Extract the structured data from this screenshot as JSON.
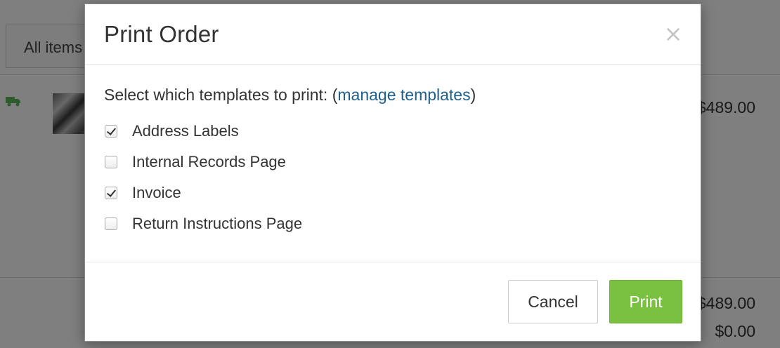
{
  "background": {
    "filter_label": "All items",
    "rows": [
      {
        "amount": "$489.00"
      }
    ],
    "totals": [
      "$489.00",
      "$0.00"
    ]
  },
  "modal": {
    "title": "Print Order",
    "close_glyph": "×",
    "prompt_prefix": "Select which templates to print: (",
    "prompt_link": "manage templates",
    "prompt_suffix": ")",
    "options": [
      {
        "label": "Address Labels",
        "checked": true
      },
      {
        "label": "Internal Records Page",
        "checked": false
      },
      {
        "label": "Invoice",
        "checked": true
      },
      {
        "label": "Return Instructions Page",
        "checked": false
      }
    ],
    "cancel_label": "Cancel",
    "print_label": "Print",
    "colors": {
      "print_button": "#7ac142",
      "link": "#1f5f8f"
    }
  },
  "icons": [
    "truck-icon",
    "close-icon",
    "checkbox-icon"
  ]
}
